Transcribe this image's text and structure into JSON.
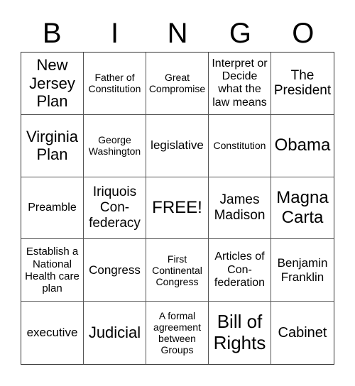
{
  "header": {
    "letters": [
      "B",
      "I",
      "N",
      "G",
      "O"
    ]
  },
  "cells": [
    "New Jersey Plan",
    "Father of Constitution",
    "Great Compromise",
    "Interpret or Decide what the law means",
    "The President",
    "Virginia Plan",
    "George Washington",
    "legislative",
    "Constitution",
    "Obama",
    "Preamble",
    "Iriquois Con- federacy",
    "FREE!",
    "James Madison",
    "Magna Carta",
    "Establish a National Health care plan",
    "Congress",
    "First Continental Congress",
    "Articles of Con- federation",
    "Benjamin Franklin",
    "executive",
    "Judicial",
    "A formal agreement between Groups",
    "Bill of Rights",
    "Cabinet"
  ]
}
